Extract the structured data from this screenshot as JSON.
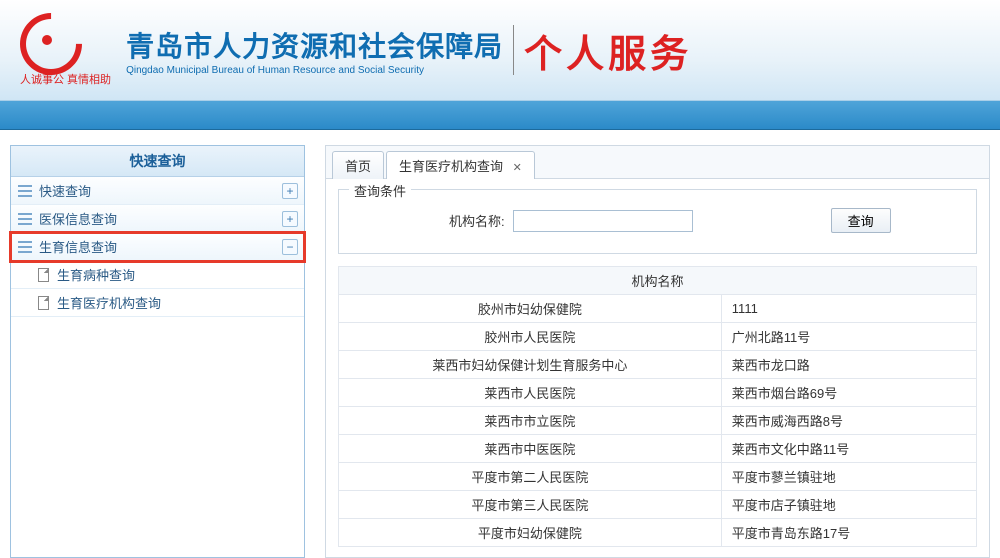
{
  "header": {
    "logo_caption": "人诚事公 真情相助",
    "org_cn": "青岛市人力资源和社会保障局",
    "org_en": "Qingdao Municipal Bureau of Human Resource and Social Security",
    "service_title": "个人服务"
  },
  "sidebar": {
    "title": "快速查询",
    "items": [
      {
        "label": "快速查询",
        "toggle": "+"
      },
      {
        "label": "医保信息查询",
        "toggle": "+"
      },
      {
        "label": "生育信息查询",
        "toggle": "−",
        "highlighted": true
      }
    ],
    "subitems": [
      {
        "label": "生育病种查询"
      },
      {
        "label": "生育医疗机构查询"
      }
    ]
  },
  "tabs": [
    {
      "label": "首页",
      "closable": false
    },
    {
      "label": "生育医疗机构查询",
      "closable": true
    }
  ],
  "form": {
    "legend": "查询条件",
    "field_label": "机构名称:",
    "field_value": "",
    "button_label": "查询"
  },
  "table": {
    "columns": [
      "机构名称",
      ""
    ],
    "rows": [
      {
        "name": "胶州市妇幼保健院",
        "addr": "1111"
      },
      {
        "name": "胶州市人民医院",
        "addr": "广州北路11号"
      },
      {
        "name": "莱西市妇幼保健计划生育服务中心",
        "addr": "莱西市龙口路"
      },
      {
        "name": "莱西市人民医院",
        "addr": "莱西市烟台路69号"
      },
      {
        "name": "莱西市市立医院",
        "addr": "莱西市威海西路8号"
      },
      {
        "name": "莱西市中医医院",
        "addr": "莱西市文化中路11号"
      },
      {
        "name": "平度市第二人民医院",
        "addr": "平度市蓼兰镇驻地"
      },
      {
        "name": "平度市第三人民医院",
        "addr": "平度市店子镇驻地"
      },
      {
        "name": "平度市妇幼保健院",
        "addr": "平度市青岛东路17号"
      }
    ]
  }
}
